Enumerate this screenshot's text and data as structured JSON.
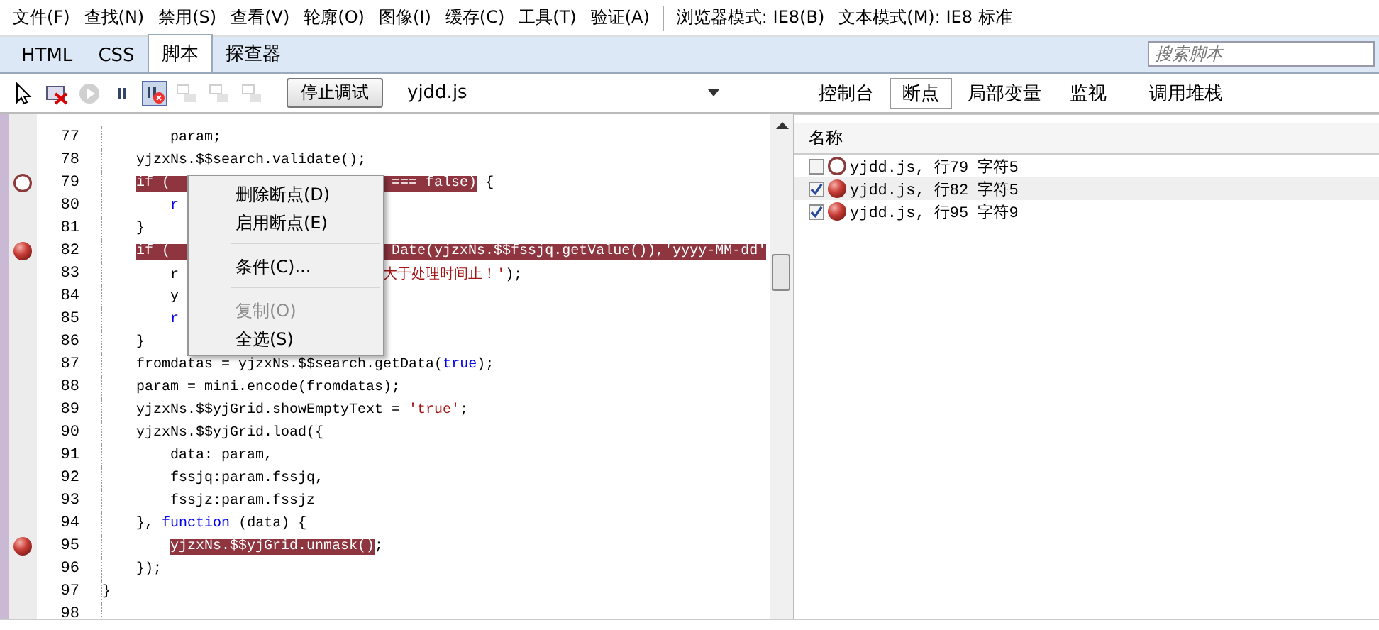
{
  "menu_bar": {
    "items": [
      "文件(F)",
      "查找(N)",
      "禁用(S)",
      "查看(V)",
      "轮廓(O)",
      "图像(I)",
      "缓存(C)",
      "工具(T)",
      "验证(A)"
    ],
    "modes": [
      "浏览器模式: IE8(B)",
      "文本模式(M):  IE8 标准"
    ]
  },
  "tabs": [
    {
      "label": "HTML",
      "selected": false
    },
    {
      "label": "CSS",
      "selected": false
    },
    {
      "label": "脚本",
      "selected": true
    },
    {
      "label": "探查器",
      "selected": false
    }
  ],
  "search": {
    "placeholder": "搜索脚本"
  },
  "toolbar": {
    "tools": [
      {
        "kind": "pointer",
        "pressed": false,
        "disabled": false
      },
      {
        "kind": "clear",
        "pressed": false,
        "disabled": false
      },
      {
        "kind": "play",
        "pressed": false,
        "disabled": true
      },
      {
        "kind": "pause",
        "pressed": false,
        "disabled": false
      },
      {
        "kind": "break-error",
        "pressed": true,
        "disabled": false
      },
      {
        "kind": "step-in",
        "pressed": false,
        "disabled": true
      },
      {
        "kind": "step-over",
        "pressed": false,
        "disabled": true
      },
      {
        "kind": "step-out",
        "pressed": false,
        "disabled": true
      }
    ],
    "stop_button": "停止调试",
    "file": "yjdd.js"
  },
  "pane_tabs": [
    {
      "label": "控制台",
      "selected": false
    },
    {
      "label": "断点",
      "selected": true
    },
    {
      "label": "局部变量",
      "selected": false
    },
    {
      "label": "监视",
      "selected": false
    },
    {
      "label": "调用堆栈",
      "selected": false
    }
  ],
  "code": {
    "lines": [
      {
        "number": "77",
        "breakpoint": false,
        "tokens": [
          {
            "text": "        param;"
          }
        ]
      },
      {
        "number": "78",
        "breakpoint": false,
        "tokens": [
          {
            "text": "    yjzxNs.$$search.validate();"
          }
        ]
      },
      {
        "number": "79",
        "breakpoint": true,
        "enabled": false,
        "tokens": [
          {
            "text": "    if (                          === false)",
            "highlighted": true
          },
          {
            "text": " {",
            "highlighted": false
          }
        ]
      },
      {
        "number": "80",
        "breakpoint": false,
        "tokens": [
          {
            "text": "        r",
            "kind": "keyword"
          }
        ]
      },
      {
        "number": "81",
        "breakpoint": false,
        "tokens": [
          {
            "text": "    }"
          }
        ]
      },
      {
        "number": "82",
        "breakpoint": true,
        "enabled": true,
        "tokens": [
          {
            "text": "    if (                          Date(yjzxNs.$$fssjq.getValue()),'yyyy-MM-dd'",
            "highlighted": true
          }
        ]
      },
      {
        "number": "83",
        "breakpoint": false,
        "tokens": [
          {
            "text": "        r"
          },
          {
            "text": "                        大于处理时间止！'",
            "kind": "string"
          },
          {
            "text": ");"
          }
        ]
      },
      {
        "number": "84",
        "breakpoint": false,
        "tokens": [
          {
            "text": "        y"
          }
        ]
      },
      {
        "number": "85",
        "breakpoint": false,
        "tokens": [
          {
            "text": "        r",
            "kind": "keyword"
          }
        ]
      },
      {
        "number": "86",
        "breakpoint": false,
        "tokens": [
          {
            "text": "    }"
          }
        ]
      },
      {
        "number": "87",
        "breakpoint": false,
        "tokens": [
          {
            "text": "    fromdatas = yjzxNs.$$search.getData("
          },
          {
            "text": "true",
            "kind": "keyword"
          },
          {
            "text": ");"
          }
        ]
      },
      {
        "number": "88",
        "breakpoint": false,
        "tokens": [
          {
            "text": "    param = mini.encode(fromdatas);"
          }
        ]
      },
      {
        "number": "89",
        "breakpoint": false,
        "tokens": [
          {
            "text": "    yjzxNs.$$yjGrid.showEmptyText = "
          },
          {
            "text": "'true'",
            "kind": "string"
          },
          {
            "text": ";"
          }
        ]
      },
      {
        "number": "90",
        "breakpoint": false,
        "tokens": [
          {
            "text": "    yjzxNs.$$yjGrid.load({"
          }
        ]
      },
      {
        "number": "91",
        "breakpoint": false,
        "tokens": [
          {
            "text": "        data: param,"
          }
        ]
      },
      {
        "number": "92",
        "breakpoint": false,
        "tokens": [
          {
            "text": "        fssjq:param.fssjq,"
          }
        ]
      },
      {
        "number": "93",
        "breakpoint": false,
        "tokens": [
          {
            "text": "        fssjz:param.fssjz"
          }
        ]
      },
      {
        "number": "94",
        "breakpoint": false,
        "tokens": [
          {
            "text": "    }, "
          },
          {
            "text": "function",
            "kind": "keyword"
          },
          {
            "text": " (data) {"
          }
        ]
      },
      {
        "number": "95",
        "breakpoint": true,
        "enabled": true,
        "tokens": [
          {
            "text": "        yjzxNs.$$yjGrid.unmask()",
            "highlighted": true
          },
          {
            "text": ";",
            "highlighted": false
          }
        ]
      },
      {
        "number": "96",
        "breakpoint": false,
        "tokens": [
          {
            "text": "    });"
          }
        ]
      },
      {
        "number": "97",
        "breakpoint": false,
        "tokens": [
          {
            "text": "}"
          }
        ]
      },
      {
        "number": "98",
        "breakpoint": false
      }
    ]
  },
  "context_menu": {
    "items": [
      {
        "kind": "item",
        "label": "删除断点(D)",
        "disabled": false
      },
      {
        "kind": "item",
        "label": "启用断点(E)",
        "disabled": false
      },
      {
        "kind": "separator"
      },
      {
        "kind": "item",
        "label": "条件(C)...",
        "disabled": false
      },
      {
        "kind": "separator"
      },
      {
        "kind": "item",
        "label": "复制(O)",
        "disabled": true
      },
      {
        "kind": "item",
        "label": "全选(S)",
        "disabled": false
      }
    ]
  },
  "breakpoints": {
    "column": "名称",
    "rows": [
      {
        "checked": false,
        "enabled": false,
        "label": "yjdd.js, 行79 字符5"
      },
      {
        "checked": true,
        "enabled": true,
        "label": "yjdd.js, 行82 字符5"
      },
      {
        "checked": true,
        "enabled": true,
        "label": "yjdd.js, 行95 字符9"
      }
    ]
  }
}
